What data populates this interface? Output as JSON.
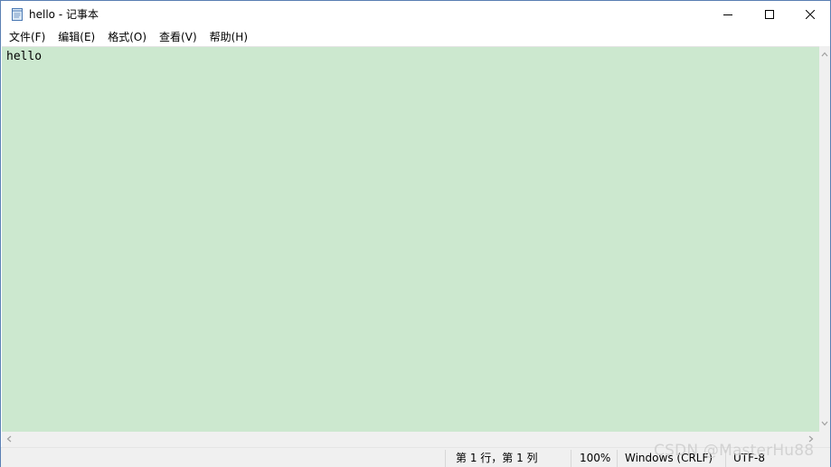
{
  "window": {
    "title": "hello - 记事本",
    "icon": "notepad-icon",
    "controls": {
      "minimize": "minimize-icon",
      "maximize": "maximize-icon",
      "close": "close-icon"
    }
  },
  "menu": {
    "items": [
      {
        "label": "文件(F)"
      },
      {
        "label": "编辑(E)"
      },
      {
        "label": "格式(O)"
      },
      {
        "label": "查看(V)"
      },
      {
        "label": "帮助(H)"
      }
    ]
  },
  "editor": {
    "content": "hello",
    "background": "#cce8cf"
  },
  "status": {
    "position": "第 1 行，第 1 列",
    "zoom": "100%",
    "line_ending": "Windows (CRLF)",
    "encoding": "UTF-8"
  },
  "watermark": "CSDN @MasterHu88"
}
